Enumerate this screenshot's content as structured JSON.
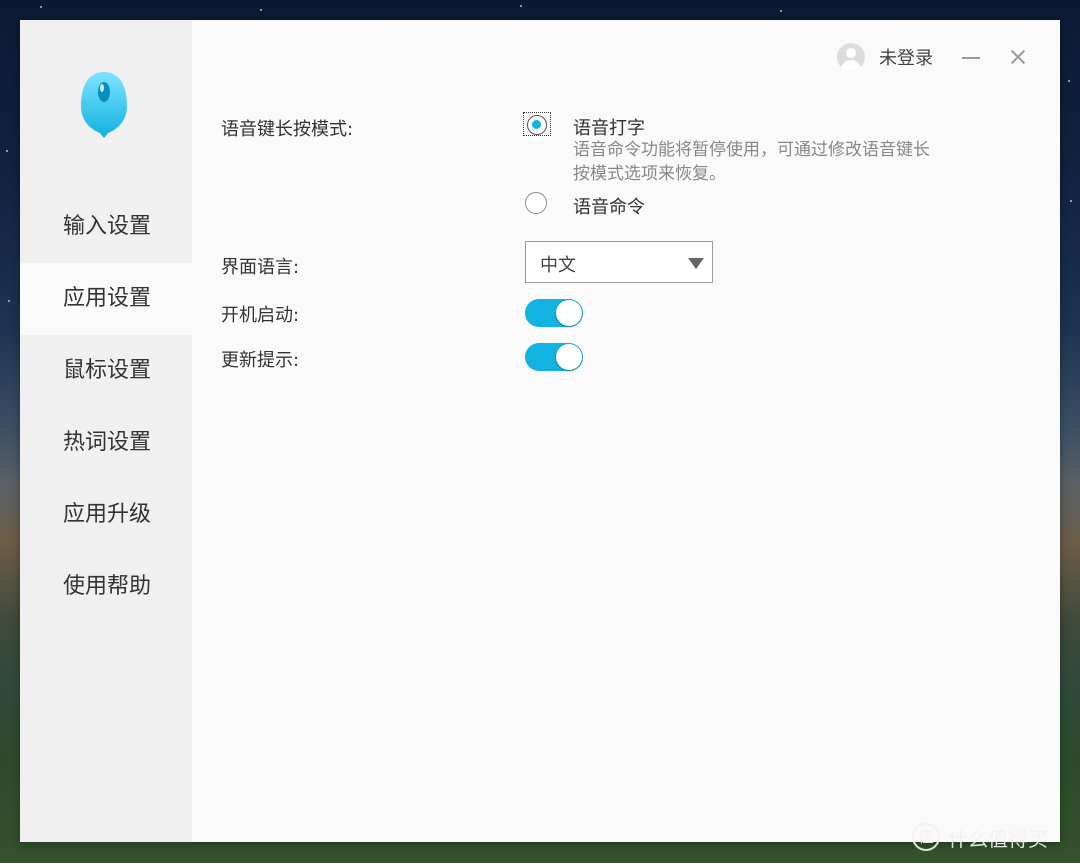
{
  "user": {
    "label": "未登录"
  },
  "sidebar": {
    "items": [
      {
        "label": "输入设置"
      },
      {
        "label": "应用设置"
      },
      {
        "label": "鼠标设置"
      },
      {
        "label": "热词设置"
      },
      {
        "label": "应用升级"
      },
      {
        "label": "使用帮助"
      }
    ],
    "active_index": 1
  },
  "settings": {
    "voice_key_mode": {
      "label": "语音键长按模式:",
      "options": [
        {
          "label": "语音打字",
          "checked": true
        },
        {
          "label": "语音命令",
          "checked": false
        }
      ],
      "description": "语音命令功能将暂停使用，可通过修改语音键长按模式选项来恢复。"
    },
    "ui_language": {
      "label": "界面语言:",
      "value": "中文"
    },
    "startup": {
      "label": "开机启动:",
      "enabled": true
    },
    "update_notice": {
      "label": "更新提示:",
      "enabled": true
    }
  },
  "colors": {
    "accent": "#12b3e0",
    "sidebar_bg": "#f0f0f0",
    "content_bg": "#fafafa"
  },
  "watermark": {
    "icon": "值",
    "text": "什么值得买"
  }
}
